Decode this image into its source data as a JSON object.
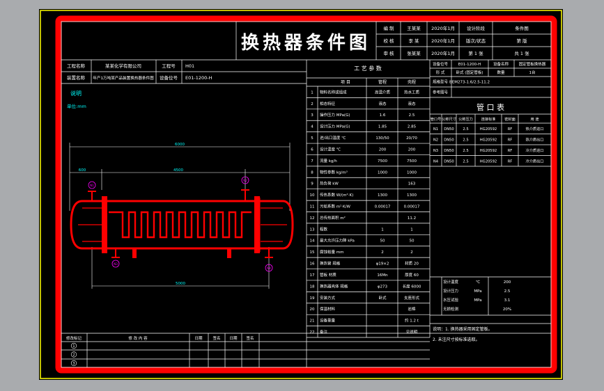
{
  "title": "换热器条件图",
  "colors": {
    "background": "#000000",
    "sheet_bg": "#a9abae",
    "border": "#ff0000",
    "frame": "#ffff00",
    "lines": "#ffffff",
    "dims": "#00ffff",
    "nozzle_marks": "#ff00ff"
  },
  "title_block": {
    "rows": [
      [
        "编 制",
        "王某某",
        "2020年1月",
        "设计阶段",
        "条件图"
      ],
      [
        "校 核",
        "李 某",
        "2020年1月",
        "版次/状态",
        "第 版"
      ],
      [
        "审 核",
        "张某某",
        "2020年1月",
        "第 1 张",
        "共 1 张"
      ]
    ]
  },
  "project_block": {
    "row1": {
      "label1": "工程名称",
      "value1": "某某化学有限公司",
      "label2": "工程号",
      "value2": "H01"
    },
    "row2": {
      "label1": "装置名称",
      "value1": "年产1万吨某产品装置换热器条件图",
      "label2": "设备位号",
      "value2": "E01-1200-H"
    }
  },
  "drawing_notes": {
    "heading": "说明",
    "sub": "单位:mm"
  },
  "dims": {
    "overall": "6000",
    "left_part": "600",
    "spacing": "4500",
    "tube_len": "5000"
  },
  "nozzles": [
    "N1",
    "N2",
    "N3",
    "N4"
  ],
  "process_params": {
    "title": "工 艺 参 数",
    "header": [
      "项 目",
      "管程",
      "壳程"
    ],
    "rows": [
      [
        "1",
        "物料名称或组成",
        "高温介质",
        "热水工质"
      ],
      [
        "2",
        "相态特征",
        "液态",
        "液态"
      ],
      [
        "3",
        "操作压力 MPa(G)",
        "1.6",
        "2.5"
      ],
      [
        "4",
        "设计压力 MPa(G)",
        "1.85",
        "2.85"
      ],
      [
        "5",
        "进/出口温度 ℃",
        "130/50",
        "20/70"
      ],
      [
        "6",
        "设计温度 ℃",
        "200",
        "200"
      ],
      [
        "7",
        "流量 kg/h",
        "7500",
        "7500"
      ],
      [
        "8",
        "物性参数 kg/m³",
        "1000",
        "1000"
      ],
      [
        "9",
        "热负荷 kW",
        "",
        "163"
      ],
      [
        "10",
        "传热系数 W/(m²·K)",
        "1300",
        "1300"
      ],
      [
        "11",
        "污垢系数 m²·K/W",
        "0.00017",
        "0.00017"
      ],
      [
        "12",
        "总传热面积 m²",
        "",
        "11.2"
      ],
      [
        "13",
        "程数",
        "1",
        "1"
      ],
      [
        "14",
        "最大允许压力降 kPa",
        "50",
        "50"
      ],
      [
        "15",
        "腐蚀裕量 mm",
        "2",
        "2"
      ],
      [
        "16",
        "换热管 规格",
        "φ19×2",
        "材质 20"
      ],
      [
        "17",
        "管板 材质",
        "16Mn",
        "厚度 60"
      ],
      [
        "18",
        "换热器壳体 规格",
        "φ273",
        "长度 6000"
      ],
      [
        "19",
        "安装方式",
        "卧式",
        "支座形式"
      ],
      [
        "20",
        "保温材料",
        "",
        "岩棉"
      ],
      [
        "21",
        "设备重量",
        "",
        "约 1.2 t"
      ],
      [
        "22",
        "备注",
        "",
        "见说明"
      ]
    ]
  },
  "equipment_info": {
    "rows": [
      [
        "设备位号",
        "E01-1200-H",
        "设备名称",
        "固定管板换热器"
      ],
      [
        "形 式",
        "卧式 (固定管板)",
        "数量",
        "1台"
      ],
      [
        "规格型号",
        "BEM273-1.6/2.5-11.2",
        "",
        ""
      ],
      [
        "参考图号",
        "",
        "",
        ""
      ]
    ]
  },
  "nozzle_table": {
    "title": "管 口 表",
    "header": [
      "管口号",
      "公称尺寸",
      "公称压力",
      "连接标准",
      "密封面",
      "用 途"
    ],
    "rows": [
      [
        "N1",
        "DN50",
        "2.5",
        "HG20592",
        "RF",
        "热介质进口"
      ],
      [
        "N2",
        "DN50",
        "2.5",
        "HG20592",
        "RF",
        "热介质出口"
      ],
      [
        "N3",
        "DN50",
        "2.5",
        "HG20592",
        "RF",
        "冷介质进口"
      ],
      [
        "N4",
        "DN50",
        "2.5",
        "HG20592",
        "RF",
        "冷介质出口"
      ]
    ]
  },
  "extra_params": {
    "rows": [
      [
        "设计温度",
        "℃",
        "200"
      ],
      [
        "设计压力",
        "MPa",
        "2.5"
      ],
      [
        "水压试验",
        "MPa",
        "3.1"
      ],
      [
        "无损检测",
        "",
        "20%"
      ]
    ]
  },
  "notes": [
    "说明：1. 换热器采用固定管板。",
    "2. 未注尺寸按标准选取。"
  ],
  "revision": {
    "header": [
      "修改标记",
      "修 改 内 容",
      "日期",
      "签名",
      "日期",
      "签名"
    ],
    "marks": [
      "1",
      "2",
      "3"
    ]
  }
}
